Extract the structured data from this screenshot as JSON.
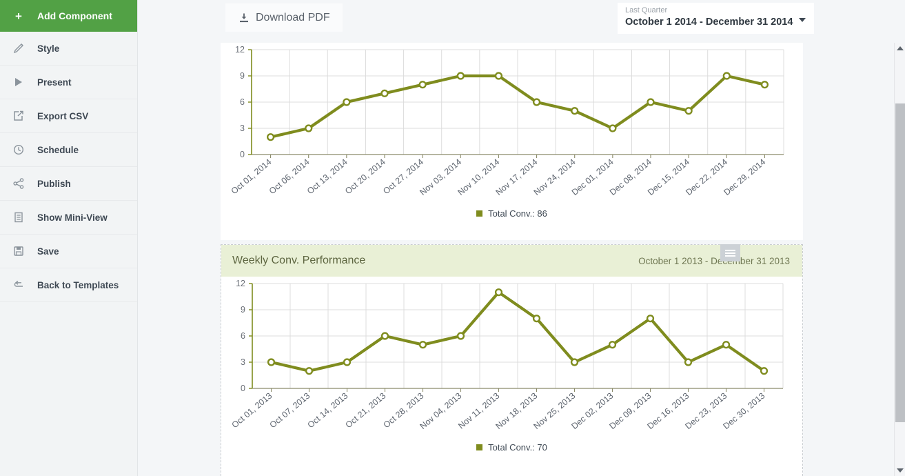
{
  "sidebar": {
    "header": {
      "label": "Add Component",
      "icon": "plus-icon"
    },
    "items": [
      {
        "label": "Style",
        "icon": "brush-icon"
      },
      {
        "label": "Present",
        "icon": "play-icon"
      },
      {
        "label": "Export CSV",
        "icon": "export-icon"
      },
      {
        "label": "Schedule",
        "icon": "clock-icon"
      },
      {
        "label": "Publish",
        "icon": "share-icon"
      },
      {
        "label": "Show Mini-View",
        "icon": "list-icon"
      },
      {
        "label": "Save",
        "icon": "floppy-disk-icon"
      },
      {
        "label": "Back to Templates",
        "icon": "back-arrow-icon"
      }
    ]
  },
  "toolbar": {
    "download_pdf_label": "Download PDF",
    "download_pdf_icon": "download-icon",
    "daterange_label": "Last Quarter",
    "daterange_value": "October 1 2014 - December 31 2014",
    "daterange_caret_icon": "chevron-down-icon"
  },
  "panels": [
    {
      "title": "",
      "range": "",
      "legend": "Total Conv.: 86",
      "handle_icon": "drag-handle-icon"
    },
    {
      "title": "Weekly Conv. Performance",
      "range": "October 1 2013 - December 31 2013",
      "legend": "Total Conv.: 70",
      "handle_icon": "drag-handle-icon"
    }
  ],
  "colors": {
    "accent_green": "#52a145",
    "series_olive": "#7f8c1e",
    "panel_header_bg": "#e9f0d6",
    "page_bg": "#f4f6f8"
  },
  "chart_data": [
    {
      "type": "line",
      "title": "",
      "xlabel": "",
      "ylabel": "",
      "ylim": [
        0,
        12
      ],
      "yticks": [
        0,
        3,
        6,
        9,
        12
      ],
      "grid": true,
      "legend_position": "bottom",
      "categories": [
        "Oct 01, 2014",
        "Oct 06, 2014",
        "Oct 13, 2014",
        "Oct 20, 2014",
        "Oct 27, 2014",
        "Nov 03, 2014",
        "Nov 10, 2014",
        "Nov 17, 2014",
        "Nov 24, 2014",
        "Dec 01, 2014",
        "Dec 08, 2014",
        "Dec 15, 2014",
        "Dec 22, 2014",
        "Dec 29, 2014"
      ],
      "series": [
        {
          "name": "Total Conv.: 86",
          "values": [
            2,
            3,
            6,
            7,
            8,
            9,
            9,
            6,
            5,
            3,
            6,
            5,
            9,
            8
          ]
        }
      ],
      "total": 86
    },
    {
      "type": "line",
      "title": "Weekly Conv. Performance",
      "xlabel": "",
      "ylabel": "",
      "ylim": [
        0,
        12
      ],
      "yticks": [
        0,
        3,
        6,
        9,
        12
      ],
      "grid": true,
      "legend_position": "bottom",
      "categories": [
        "Oct 01, 2013",
        "Oct 07, 2013",
        "Oct 14, 2013",
        "Oct 21, 2013",
        "Oct 28, 2013",
        "Nov 04, 2013",
        "Nov 11, 2013",
        "Nov 18, 2013",
        "Nov 25, 2013",
        "Dec 02, 2013",
        "Dec 09, 2013",
        "Dec 16, 2013",
        "Dec 23, 2013",
        "Dec 30, 2013"
      ],
      "series": [
        {
          "name": "Total Conv.: 70",
          "values": [
            3,
            2,
            3,
            6,
            5,
            6,
            11,
            8,
            3,
            5,
            8,
            3,
            5,
            2
          ]
        }
      ],
      "total": 70
    }
  ],
  "scrollbar": {
    "up_icon": "scroll-up-arrow-icon",
    "down_icon": "scroll-down-arrow-icon"
  }
}
